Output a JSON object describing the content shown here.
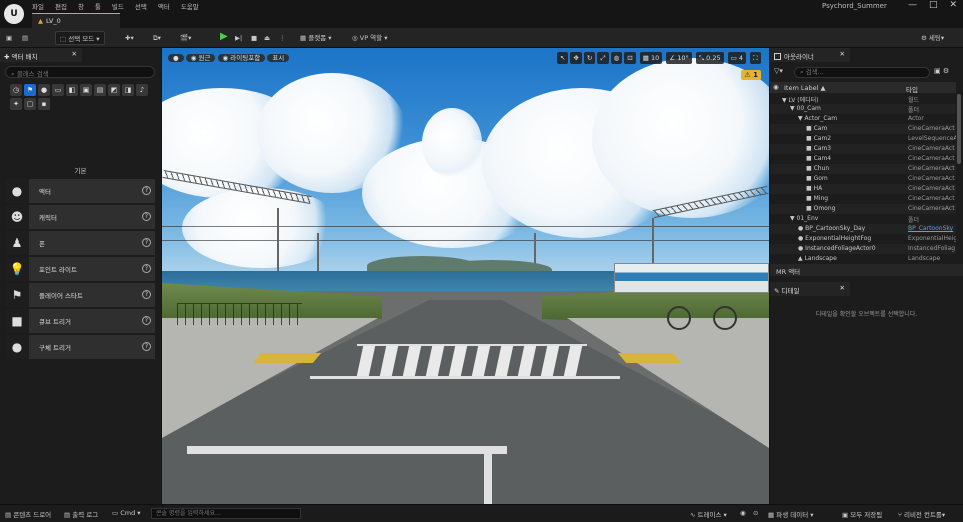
{
  "titlebar": {
    "logo": "U",
    "menu": [
      "파일",
      "편집",
      "창",
      "툴",
      "빌드",
      "선택",
      "액터",
      "도움말"
    ],
    "level_tab": "LV_0",
    "project": "Psychord_Summer",
    "minimize": "—",
    "maximize": "□",
    "close": "✕"
  },
  "toolbar": {
    "select_mode": "선택 모드",
    "platforms": "플랫폼",
    "vp_label": "VP 역할",
    "settings": "세팅"
  },
  "place_actors": {
    "tab_title": "액터 배치",
    "search_placeholder": "클래스 검색",
    "category_icons": [
      "clock-icon",
      "shapes-icon",
      "light-icon",
      "cinematic-icon",
      "visual-icon",
      "volume-icon",
      "all-classes-icon",
      "geometry-icon",
      "navigation-icon",
      "audio-icon",
      "effects-icon",
      "other-icon"
    ],
    "section_label": "기본",
    "items": [
      {
        "name": "액터",
        "icon": "sphere-icon",
        "help": "?"
      },
      {
        "name": "캐릭터",
        "icon": "character-icon",
        "help": "?"
      },
      {
        "name": "폰",
        "icon": "pawn-icon",
        "help": "?"
      },
      {
        "name": "포인트 라이트",
        "icon": "point-light-icon",
        "help": "?"
      },
      {
        "name": "플레이어 스타트",
        "icon": "player-start-icon",
        "help": "?"
      },
      {
        "name": "큐브 트리거",
        "icon": "cube-trigger-icon",
        "help": "?"
      },
      {
        "name": "구체 트리거",
        "icon": "sphere-trigger-icon",
        "help": "?"
      }
    ]
  },
  "viewport": {
    "perspective": "원근",
    "lit": "라이팅포함",
    "show": "표시",
    "grid_snap": "10",
    "rotation_snap": "10°",
    "scale_snap": "0.25",
    "camera_speed": "4",
    "warning_count": "1"
  },
  "outliner": {
    "tab_title": "아웃라이너",
    "search_placeholder": "검색...",
    "col_label": "Item Label ▲",
    "col_type": "타입",
    "rows": [
      {
        "label": "LV (에디터)",
        "type": "월드",
        "indent": 1,
        "icon": "▼",
        "link": false
      },
      {
        "label": "00_Cam",
        "type": "폴더",
        "indent": 2,
        "icon": "▼",
        "link": false
      },
      {
        "label": "Actor_Cam",
        "type": "Actor",
        "indent": 3,
        "icon": "▼",
        "link": false
      },
      {
        "label": "Cam",
        "type": "CineCameraAct",
        "indent": 4,
        "icon": "■",
        "link": false
      },
      {
        "label": "Cam2",
        "type": "LevelSequenceA",
        "indent": 4,
        "icon": "■",
        "link": false
      },
      {
        "label": "Cam3",
        "type": "CineCameraAct",
        "indent": 4,
        "icon": "■",
        "link": false
      },
      {
        "label": "Cam4",
        "type": "CineCameraAct",
        "indent": 4,
        "icon": "■",
        "link": false
      },
      {
        "label": "Chun",
        "type": "CineCameraAct",
        "indent": 4,
        "icon": "■",
        "link": false
      },
      {
        "label": "Gom",
        "type": "CineCameraAct",
        "indent": 4,
        "icon": "■",
        "link": false
      },
      {
        "label": "HA",
        "type": "CineCameraAct",
        "indent": 4,
        "icon": "■",
        "link": false
      },
      {
        "label": "Ming",
        "type": "CineCameraAct",
        "indent": 4,
        "icon": "■",
        "link": false
      },
      {
        "label": "Omong",
        "type": "CineCameraAct",
        "indent": 4,
        "icon": "■",
        "link": false
      },
      {
        "label": "01_Env",
        "type": "폴더",
        "indent": 2,
        "icon": "▼",
        "link": false
      },
      {
        "label": "BP_CartoonSky_Day",
        "type": "BP_CartoonSky",
        "indent": 3,
        "icon": "●",
        "link": true
      },
      {
        "label": "ExponentialHeightFog",
        "type": "ExponentialHeig",
        "indent": 3,
        "icon": "●",
        "link": false
      },
      {
        "label": "InstancedFoliageActor0",
        "type": "InstancedFoliag",
        "indent": 3,
        "icon": "●",
        "link": false
      },
      {
        "label": "Landscape",
        "type": "Landscape",
        "indent": 3,
        "icon": "▲",
        "link": false
      }
    ],
    "mode_label": "MR 액터"
  },
  "details": {
    "tab_title": "디테일",
    "empty_message": "디테일을 확인할 오브젝트를 선택합니다."
  },
  "statusbar": {
    "content_drawer": "콘텐츠 드로어",
    "output_log": "출력 로그",
    "cmd": "Cmd",
    "cmd_placeholder": "콘솔 명령을 입력하세요...",
    "trace": "트레이스",
    "derived_data": "파생 데이터",
    "all_saved": "모두 저장됨",
    "revision_control": "리비전 컨트롤"
  },
  "colors": {
    "accent_blue": "#1a6ad3",
    "play_green": "#4ec94e",
    "tab_accent": "#e0a23a",
    "warning": "#e3b331"
  }
}
